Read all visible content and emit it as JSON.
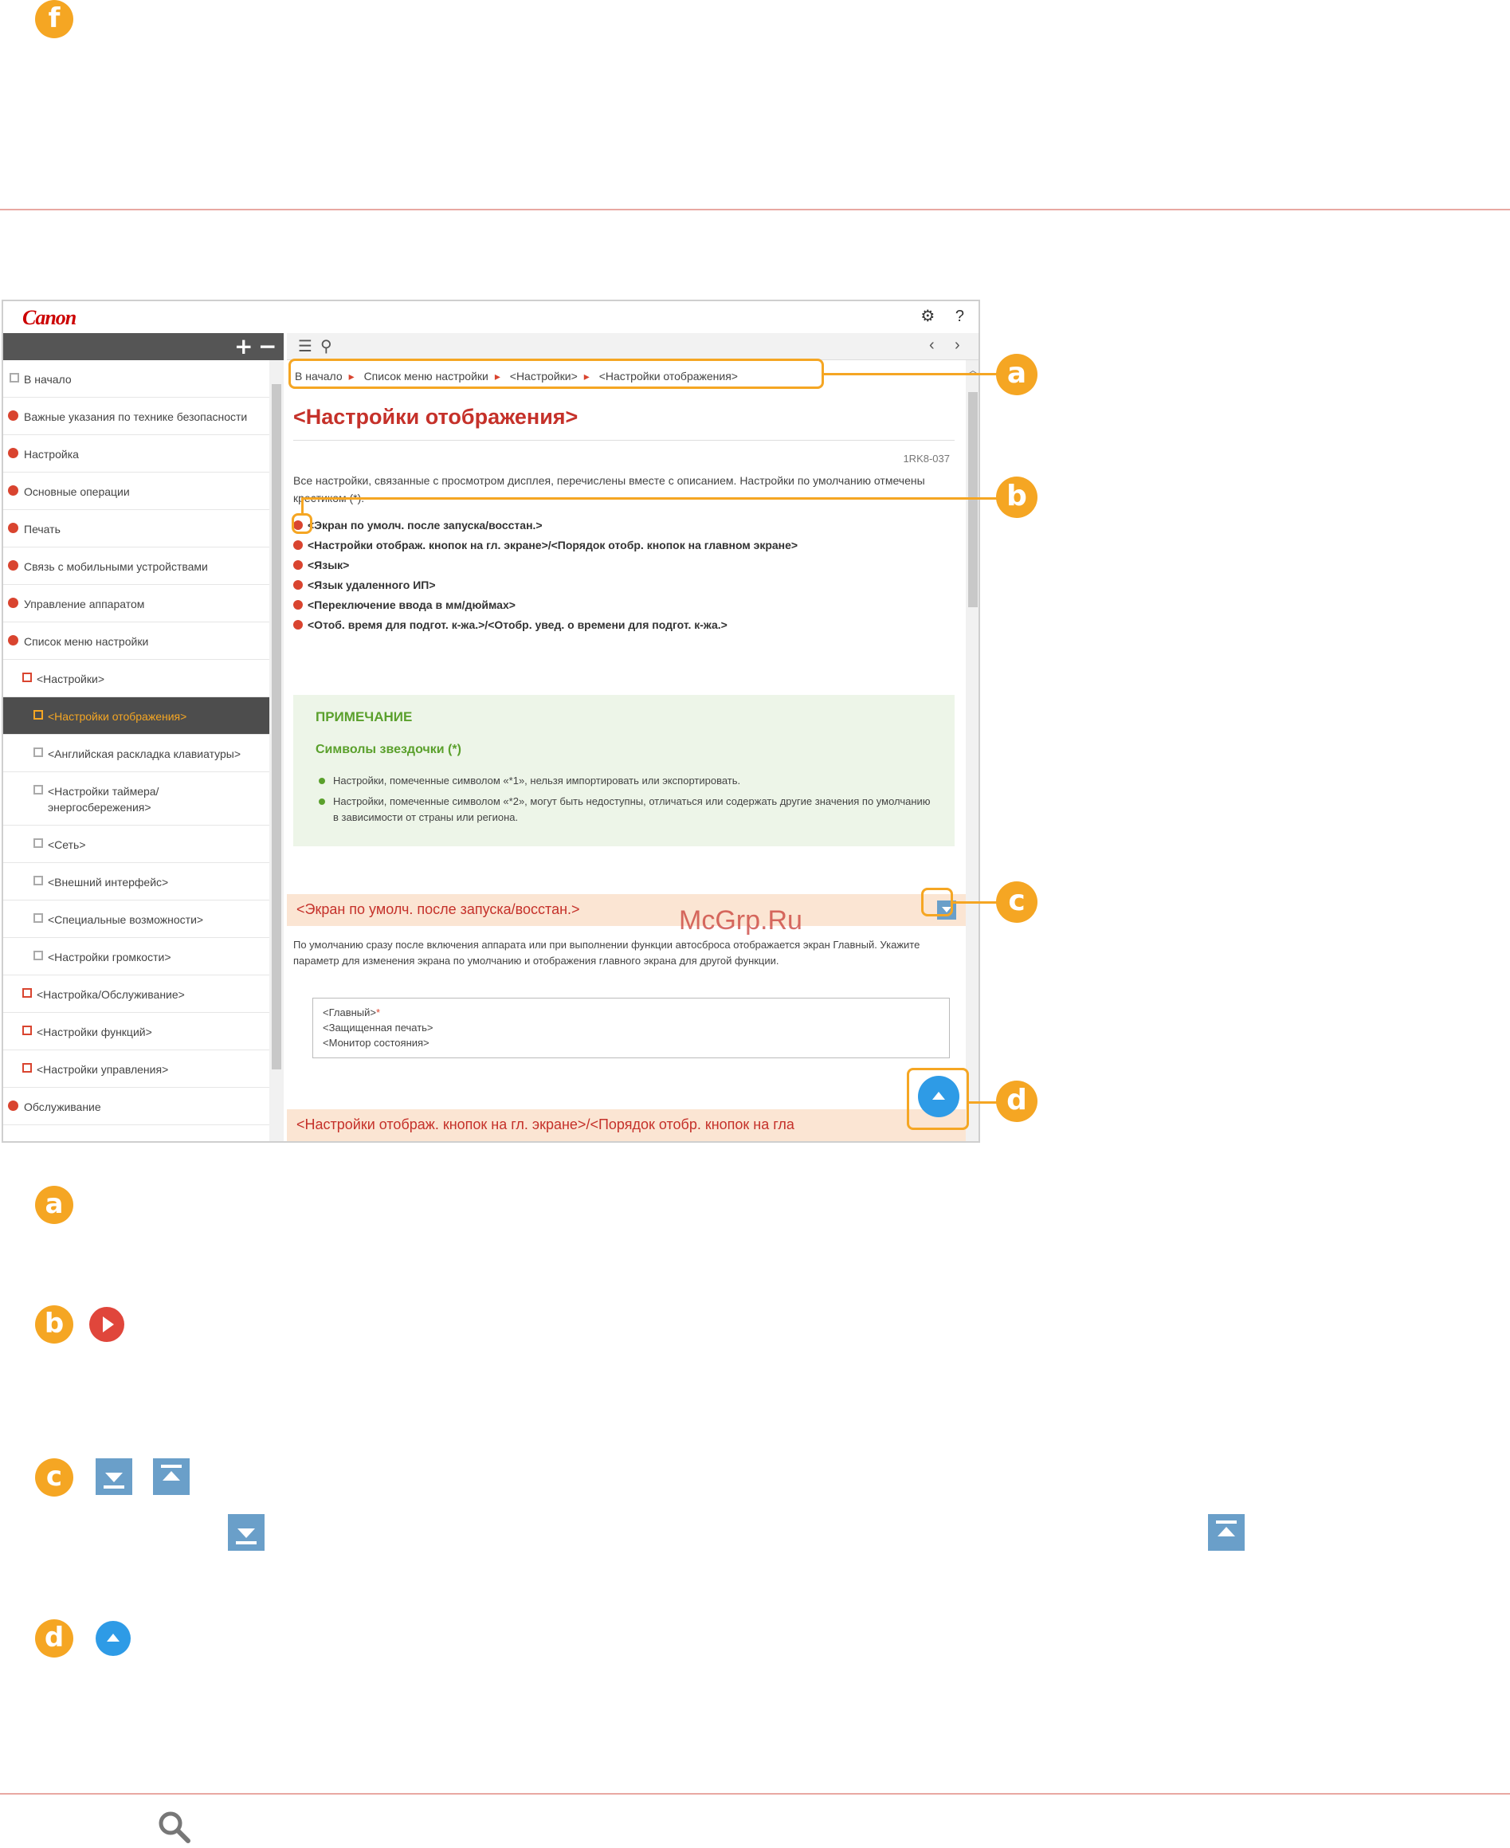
{
  "markers": {
    "f": "f",
    "a": "a",
    "b": "b",
    "c": "c",
    "d": "d"
  },
  "brand": {
    "logo": "Canon",
    "accent": "#f5a623",
    "red": "#c5312a"
  },
  "topbar_icons": [
    "gear-icon",
    "help-icon"
  ],
  "sidebar": {
    "controls": [
      "+",
      "−"
    ],
    "items": [
      {
        "label": "В начало",
        "level": 0,
        "marker": "square-gray"
      },
      {
        "label": "Важные указания по технике безопасности",
        "level": 0,
        "marker": "dot"
      },
      {
        "label": "Настройка",
        "level": 0,
        "marker": "dot"
      },
      {
        "label": "Основные операции",
        "level": 0,
        "marker": "dot"
      },
      {
        "label": "Печать",
        "level": 0,
        "marker": "dot"
      },
      {
        "label": "Связь с мобильными устройствами",
        "level": 0,
        "marker": "dot"
      },
      {
        "label": "Управление аппаратом",
        "level": 0,
        "marker": "dot"
      },
      {
        "label": "Список меню настройки",
        "level": 0,
        "marker": "dot"
      },
      {
        "label": "<Настройки>",
        "level": 1,
        "marker": "square"
      },
      {
        "label": "<Настройки отображения>",
        "level": 2,
        "marker": "square",
        "selected": true
      },
      {
        "label": "<Английская раскладка клавиатуры>",
        "level": 2,
        "marker": "square-gray"
      },
      {
        "label": "<Настройки таймера/энергосбережения>",
        "level": 2,
        "marker": "square-gray"
      },
      {
        "label": "<Сеть>",
        "level": 2,
        "marker": "square-gray"
      },
      {
        "label": "<Внешний интерфейс>",
        "level": 2,
        "marker": "square-gray"
      },
      {
        "label": "<Специальные возможности>",
        "level": 2,
        "marker": "square-gray"
      },
      {
        "label": "<Настройки громкости>",
        "level": 2,
        "marker": "square-gray"
      },
      {
        "label": "<Настройка/Обслуживание>",
        "level": 1,
        "marker": "square"
      },
      {
        "label": "<Настройки функций>",
        "level": 1,
        "marker": "square"
      },
      {
        "label": "<Настройки управления>",
        "level": 1,
        "marker": "square"
      },
      {
        "label": "Обслуживание",
        "level": 0,
        "marker": "dot"
      }
    ]
  },
  "toolbar": {
    "icons": [
      "list-icon",
      "search-icon",
      "back-icon",
      "forward-icon"
    ]
  },
  "content": {
    "breadcrumb": [
      "В начало",
      "Список меню настройки",
      "<Настройки>",
      "<Настройки отображения>"
    ],
    "title": "<Настройки отображения>",
    "doc_code": "1RK8-037",
    "intro": "Все настройки, связанные с просмотром дисплея, перечислены вместе с описанием. Настройки по умолчанию отмечены крестиком (*).",
    "links": [
      "<Экран по умолч. после запуска/восстан.>",
      "<Настройки отображ. кнопок на гл. экране>/<Порядок отобр. кнопок на главном экране>",
      "<Язык>",
      "<Язык удаленного ИП>",
      "<Переключение ввода в мм/дюймах>",
      "<Отоб. время для подгот. к-жа.>/<Отобр. увед. о времени для подгот. к-жа.>"
    ],
    "note": {
      "title": "ПРИМЕЧАНИЕ",
      "subtitle": "Символы звездочки (*)",
      "items": [
        "Настройки, помеченные символом «*1», нельзя импортировать или экспортировать.",
        "Настройки, помеченные символом «*2», могут быть недоступны, отличаться или содержать другие значения по умолчанию в зависимости от страны или региона."
      ]
    },
    "section1": {
      "title": "<Экран по умолч. после запуска/восстан.>",
      "text": "По умолчанию сразу после включения аппарата или при выполнении функции автосброса отображается экран Главный. Укажите параметр для изменения экрана по умолчанию и отображения главного экрана для другой функции.",
      "options": [
        "<Главный>",
        "<Защищенная печать>",
        "<Монитор состояния>"
      ],
      "default_mark": "*"
    },
    "section2": {
      "title": "<Настройки отображ. кнопок на гл. экране>/<Порядок отобр. кнопок на гла"
    }
  },
  "watermark": "McGrp.Ru",
  "legend_icons": [
    "red-play-icon",
    "expand-down-icon",
    "collapse-up-icon",
    "scroll-top-icon",
    "magnifier-icon"
  ]
}
